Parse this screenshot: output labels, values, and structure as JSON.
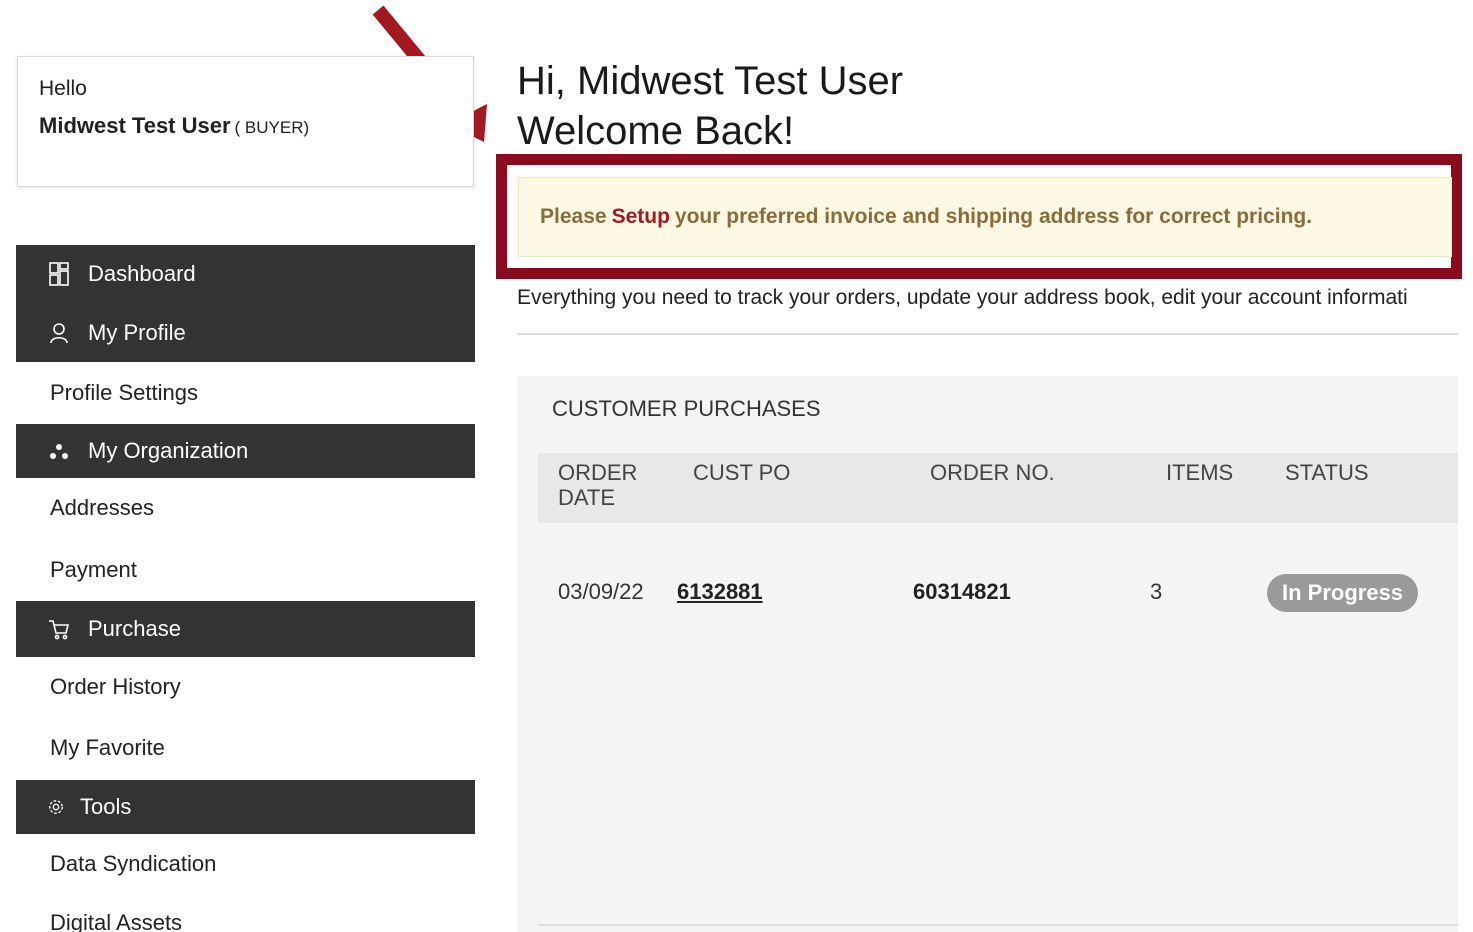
{
  "greeting_card": {
    "hello": "Hello",
    "user_name": "Midwest Test User",
    "role": "( BUYER)"
  },
  "sidebar": {
    "dashboard": "Dashboard",
    "my_profile": "My Profile",
    "profile_settings": "Profile Settings",
    "my_organization": "My Organization",
    "addresses": "Addresses",
    "payment": "Payment",
    "purchase": "Purchase",
    "order_history": "Order History",
    "my_favorite": "My Favorite",
    "tools": "Tools",
    "data_syndication": "Data Syndication",
    "digital_assets": "Digital Assets"
  },
  "main": {
    "title_line1": "Hi, Midwest Test User",
    "title_line2": "Welcome Back!",
    "notice": {
      "before": "Please",
      "link": "Setup",
      "after": "your preferred invoice and shipping address for correct pricing."
    },
    "intro": "Everything you need to track your orders, update your address book, edit your account informati"
  },
  "purchases": {
    "heading": "CUSTOMER PURCHASES",
    "columns": {
      "order_date_1": "ORDER",
      "order_date_2": "DATE",
      "cust_po": "CUST PO",
      "order_no": "ORDER NO.",
      "items": "ITEMS",
      "status": "STATUS"
    },
    "rows": [
      {
        "order_date": "03/09/22",
        "cust_po": "6132881",
        "order_no": "60314821",
        "items": "3",
        "status": "In Progress"
      }
    ]
  },
  "colors": {
    "sidebar_dark": "#333333",
    "callout_border": "#8b0a1d",
    "notice_bg": "#fcf8e3",
    "notice_text": "#8a6d3b",
    "setup_link": "#a31922",
    "status_badge": "#9a9a9a"
  },
  "icons": {
    "dashboard": "dashboard-icon",
    "profile": "user-icon",
    "organization": "organization-icon",
    "purchase": "cart-icon",
    "tools": "gear-icon"
  }
}
